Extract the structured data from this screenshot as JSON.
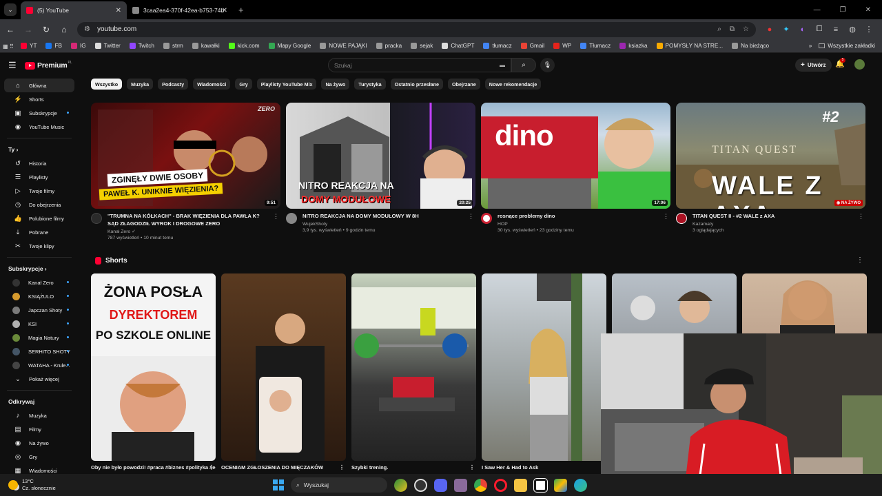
{
  "browser": {
    "tabs": [
      {
        "title": "(5) YouTube",
        "active": true
      },
      {
        "title": "3caa2ea4-370f-42ea-b753-74b",
        "active": false
      }
    ],
    "url": "youtube.com",
    "bookmarks": [
      {
        "label": "YT",
        "color": "#ff0033"
      },
      {
        "label": "FB",
        "color": "#1877f2"
      },
      {
        "label": "IG",
        "color": "#d62976"
      },
      {
        "label": "Twitter",
        "color": "#dddddd"
      },
      {
        "label": "Twitch",
        "color": "#9146ff"
      },
      {
        "label": "strm",
        "color": "#999999"
      },
      {
        "label": "kawałki",
        "color": "#999999"
      },
      {
        "label": "kick.com",
        "color": "#53fc18"
      },
      {
        "label": "Mapy Google",
        "color": "#34a853"
      },
      {
        "label": "NOWE PAJĄKI",
        "color": "#999999"
      },
      {
        "label": "pracka",
        "color": "#999999"
      },
      {
        "label": "sejak",
        "color": "#999999"
      },
      {
        "label": "ChatGPT",
        "color": "#dddddd"
      },
      {
        "label": "tłumacz",
        "color": "#4285f4"
      },
      {
        "label": "Gmail",
        "color": "#ea4335"
      },
      {
        "label": "WP",
        "color": "#e5231b"
      },
      {
        "label": "Tłumacz",
        "color": "#4285f4"
      },
      {
        "label": "ksiazka",
        "color": "#9c27b0"
      },
      {
        "label": "POMYSŁY NA STRE...",
        "color": "#f9ab00"
      },
      {
        "label": "Na bieżąco",
        "color": "#999999"
      }
    ],
    "bookmarks_right": "Wszystkie zakładki"
  },
  "youtube": {
    "logo": "Premium",
    "logo_cc": "PL",
    "search_placeholder": "Szukaj",
    "create_label": "Utwórz",
    "notif_count": "5",
    "sidebar": {
      "main": [
        {
          "label": "Główna",
          "icon": "home-icon",
          "glyph": "⌂",
          "active": true
        },
        {
          "label": "Shorts",
          "icon": "shorts-icon",
          "glyph": "⚡"
        },
        {
          "label": "Subskrypcje",
          "icon": "subscriptions-icon",
          "glyph": "▣",
          "dot": true
        },
        {
          "label": "YouTube Music",
          "icon": "music-icon",
          "glyph": "◉"
        }
      ],
      "you_heading": "Ty  ›",
      "you": [
        {
          "label": "Historia",
          "icon": "history-icon",
          "glyph": "↺"
        },
        {
          "label": "Playlisty",
          "icon": "playlist-icon",
          "glyph": "☰"
        },
        {
          "label": "Twoje filmy",
          "icon": "your-videos-icon",
          "glyph": "▷"
        },
        {
          "label": "Do obejrzenia",
          "icon": "watch-later-icon",
          "glyph": "◷"
        },
        {
          "label": "Polubione filmy",
          "icon": "like-icon",
          "glyph": "👍"
        },
        {
          "label": "Pobrane",
          "icon": "download-icon",
          "glyph": "⤓"
        },
        {
          "label": "Twoje klipy",
          "icon": "clips-icon",
          "glyph": "✂"
        }
      ],
      "subs_heading": "Subskrypcje  ›",
      "subs": [
        {
          "label": "Kanał Zero",
          "color": "#333333",
          "dot": true
        },
        {
          "label": "KSIĄŻULO",
          "color": "#d69a2d",
          "dot": true
        },
        {
          "label": "Japczan Shoty",
          "color": "#7a7a7a",
          "dot": true
        },
        {
          "label": "KSI",
          "color": "#b0b0b0",
          "dot": true
        },
        {
          "label": "Magia Natury",
          "color": "#6a8a3a",
          "dot": true
        },
        {
          "label": "SERHITO SHOTY",
          "color": "#445566",
          "dot": true
        },
        {
          "label": "WATAHA - Krule...",
          "color": "#444444",
          "dot": true
        }
      ],
      "show_more": "Pokaż więcej",
      "explore_heading": "Odkrywaj",
      "explore": [
        {
          "label": "Muzyka",
          "icon": "music-note-icon",
          "glyph": "♪"
        },
        {
          "label": "Filmy",
          "icon": "film-icon",
          "glyph": "▤"
        },
        {
          "label": "Na żywo",
          "icon": "live-icon",
          "glyph": "◉"
        },
        {
          "label": "Gry",
          "icon": "gaming-icon",
          "glyph": "◎"
        },
        {
          "label": "Wiadomości",
          "icon": "news-icon",
          "glyph": "▦"
        }
      ]
    },
    "chips": [
      "Wszystko",
      "Muzyka",
      "Podcasty",
      "Wiadomości",
      "Gry",
      "Playlisty YouTube Mix",
      "Na żywo",
      "Turystyka",
      "Ostatnio przesłane",
      "Obejrzane",
      "Nowe rekomendacje"
    ],
    "videos": [
      {
        "title": "\"TRUMNA NA KÓŁKACH\" - BRAK WIĘZIENIA DLA PAWŁA K? SĄD ZŁAGODZIŁ WYROK I DROGOWE ZERO",
        "channel": "Kanał Zero",
        "stats": "787 wyświetleń • 10 minut temu",
        "duration": "9:51",
        "thumb_line1": "ZGINĘŁY DWIE OSOBY",
        "thumb_line2": "PAWEŁ K. UNIKNIE WIĘZIENIA?",
        "badge": "ZERO",
        "avatar": "#2a2a2a"
      },
      {
        "title": "NITRO REAKCJA NA DOMY MODUŁOWY W 8H",
        "channel": "WujekShoty",
        "stats": "3,9 tys. wyświetleń • 9 godzin temu",
        "duration": "20:25",
        "thumb_line1": "NITRO REAKCJA NA",
        "thumb_line2": "DOMY MODUŁOWE",
        "avatar": "#888888"
      },
      {
        "title": "rosnące problemy dino",
        "channel": "HOP",
        "stats": "30 tys. wyświetleń • 23 godziny temu",
        "duration": "17:06",
        "thumb_line1": "dino",
        "avatar": "#cc2233"
      },
      {
        "title": "TITAN QUEST II - #2 WALE z AXA",
        "channel": "Kazamaty",
        "stats": "3 oglądających",
        "live": "NA ŻYWO",
        "thumb_line1": "TITAN QUEST",
        "thumb_line2": "WALE Z AXA",
        "thumb_tag": "#2",
        "avatar": "#aa1122"
      }
    ],
    "shorts_heading": "Shorts",
    "shorts": [
      {
        "title": "Oby nie było powodzi! #praca #biznes #polityka #edukacja",
        "thumb_line1": "ŻONA POSŁA",
        "thumb_line2": "DYREKTOREM",
        "thumb_line3": "PO SZKOLE ONLINE"
      },
      {
        "title": "OCENIAM ZGŁOSZENIA DO MIĘCZAKÓW"
      },
      {
        "title": "Szybki trening."
      },
      {
        "title": "I Saw Her & Had to Ask"
      },
      {
        "title": ""
      },
      {
        "title": ""
      }
    ]
  },
  "taskbar": {
    "temp": "13°C",
    "weather": "Cz. słonecznie",
    "search": "Wyszukaj"
  },
  "colors": {
    "bg": "#0f0f0f",
    "accent": "#ff0033",
    "chip": "#272727"
  }
}
